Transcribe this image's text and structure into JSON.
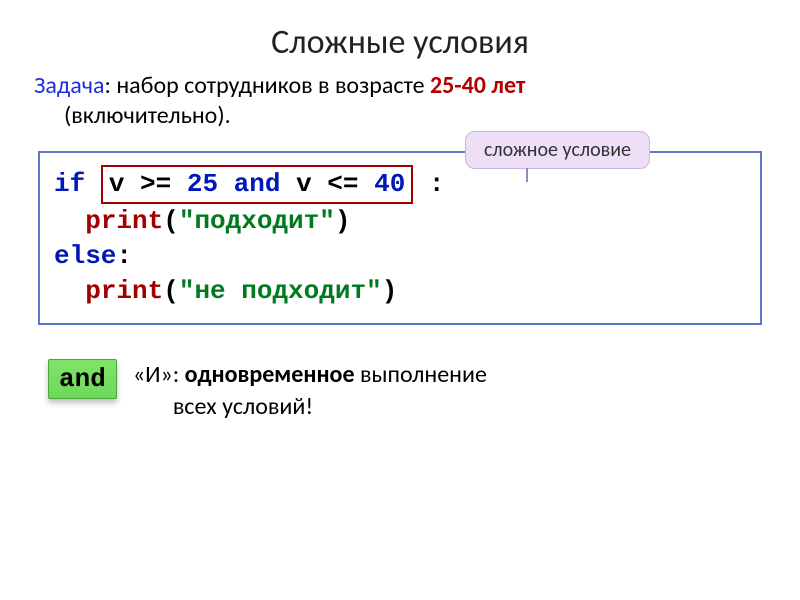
{
  "title": "Сложные условия",
  "task": {
    "label": "Задача",
    "prefix": ": набор сотрудников в возрасте ",
    "age": "25-40 лет",
    "suffix": " (включительно)."
  },
  "callout": "сложное условие",
  "code": {
    "if_kw": "if",
    "cond_part1": "v >= ",
    "cond_num1": "25",
    "cond_and": " and ",
    "cond_part2": "v <= ",
    "cond_num2": "40",
    "colon": ":",
    "print_kw": "print",
    "lparen": "(",
    "rparen": ")",
    "str_ok": "\"подходит\"",
    "else_kw": "else",
    "str_no": "\"не подходит\""
  },
  "and_block": {
    "badge": "and",
    "desc_prefix": "«И»: ",
    "desc_bold": "одновременное",
    "desc_rest1": " выполнение",
    "desc_rest2": "всех условий!"
  }
}
